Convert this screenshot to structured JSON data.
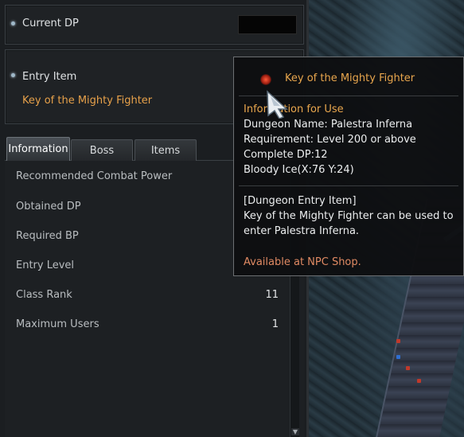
{
  "current_dp": {
    "label": "Current DP"
  },
  "entry": {
    "label": "Entry Item",
    "item_name": "Key of the Mighty Fighter"
  },
  "tabs": [
    {
      "label": "Information"
    },
    {
      "label": "Boss"
    },
    {
      "label": "Items"
    }
  ],
  "info_rows": [
    {
      "key": "Recommended Combat Power",
      "value": ""
    },
    {
      "key": "Obtained DP",
      "value": ""
    },
    {
      "key": "Required BP",
      "value": ""
    },
    {
      "key": "Entry Level",
      "value": ""
    },
    {
      "key": "Class Rank",
      "value": "11"
    },
    {
      "key": "Maximum Users",
      "value": "1"
    }
  ],
  "tooltip": {
    "title": "Key of the Mighty Fighter",
    "usage_heading": "Information for Use",
    "dungeon_name": "Dungeon Name: Palestra Inferna",
    "requirement": "Requirement: Level 200 or above",
    "complete_dp": "Complete DP:12",
    "location": "Bloody Ice(X:76 Y:24)",
    "entry_item_heading": "[Dungeon Entry Item]",
    "description_line1": "Key of the Mighty Fighter can be used to",
    "description_line2": "enter Palestra Inferna.",
    "availability": "Available at NPC Shop."
  },
  "scrollbar": {
    "down_icon": "triangle-down-icon"
  },
  "colors": {
    "item_orange": "#e8a64d",
    "panel_bg": "#1b1e21",
    "tooltip_bg": "#0e0f11",
    "availability": "#e08a63"
  }
}
